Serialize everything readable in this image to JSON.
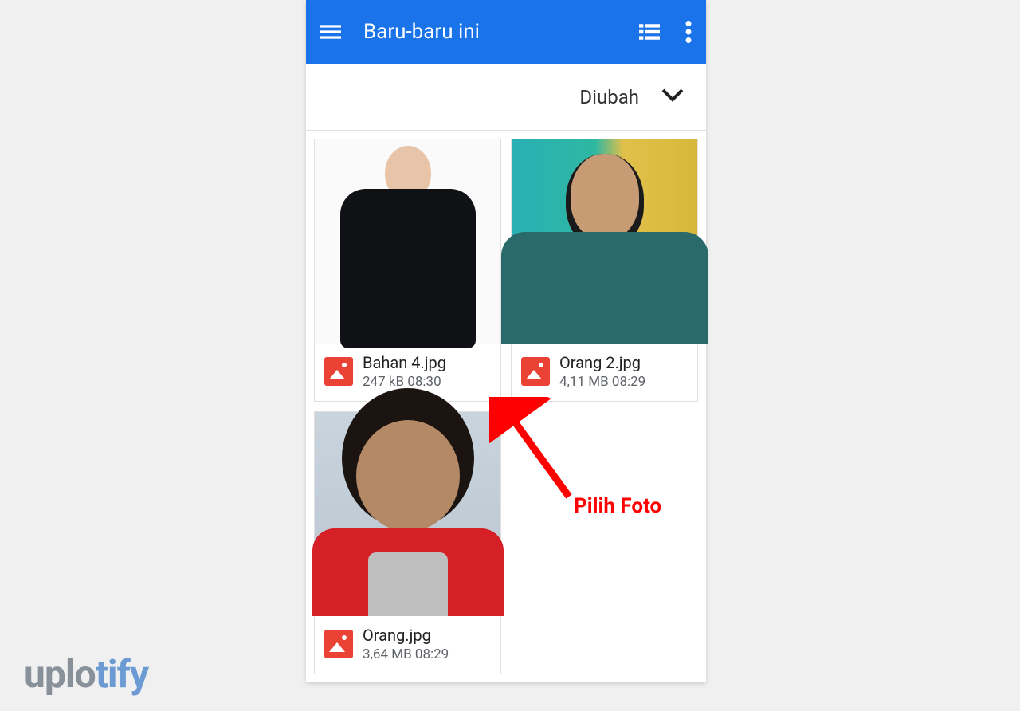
{
  "appbar": {
    "title": "Baru-baru ini"
  },
  "sort": {
    "label": "Diubah"
  },
  "files": [
    {
      "name": "Bahan 4.jpg",
      "size": "247 kB",
      "time": "08:30"
    },
    {
      "name": "Orang 2.jpg",
      "size": "4,11 MB",
      "time": "08:29"
    },
    {
      "name": "Orang.jpg",
      "size": "3,64 MB",
      "time": "08:29"
    }
  ],
  "annotation": {
    "text": "Pilih Foto",
    "color": "#ff0000"
  },
  "watermark": {
    "part1": "uplo",
    "part2": "tify"
  }
}
